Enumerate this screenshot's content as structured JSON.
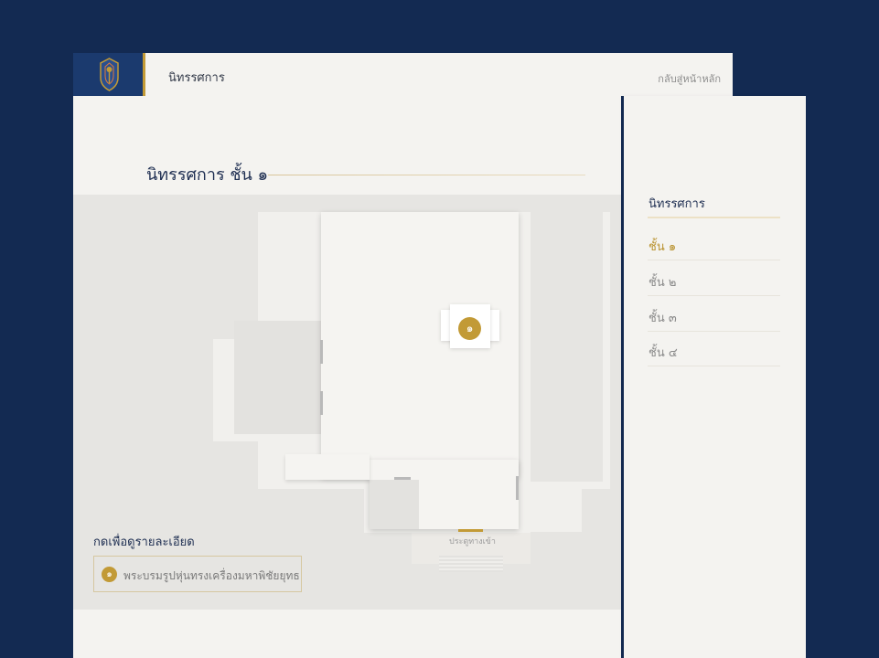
{
  "header": {
    "title": "นิทรรศการ",
    "back_label": "กลับสู่หน้าหลัก",
    "accent_color": "#c29a36",
    "brand_color": "#1b3a6e"
  },
  "main": {
    "page_title": "นิทรรศการ ชั้น ๑",
    "map": {
      "gate_label": "ประตูทางเข้า",
      "pin_number": "๑"
    },
    "legend": {
      "title": "กดเพื่อดูรายละเอียด",
      "items": [
        {
          "number": "๑",
          "label": "พระบรมรูปหุ่นทรงเครื่องมหาพิชัยยุทธ"
        }
      ]
    }
  },
  "sidebar": {
    "title": "นิทรรศการ",
    "floors": [
      {
        "label": "ชั้น ๑",
        "active": true
      },
      {
        "label": "ชั้น ๒",
        "active": false
      },
      {
        "label": "ชั้น ๓",
        "active": false
      },
      {
        "label": "ชั้น ๔",
        "active": false
      }
    ]
  }
}
